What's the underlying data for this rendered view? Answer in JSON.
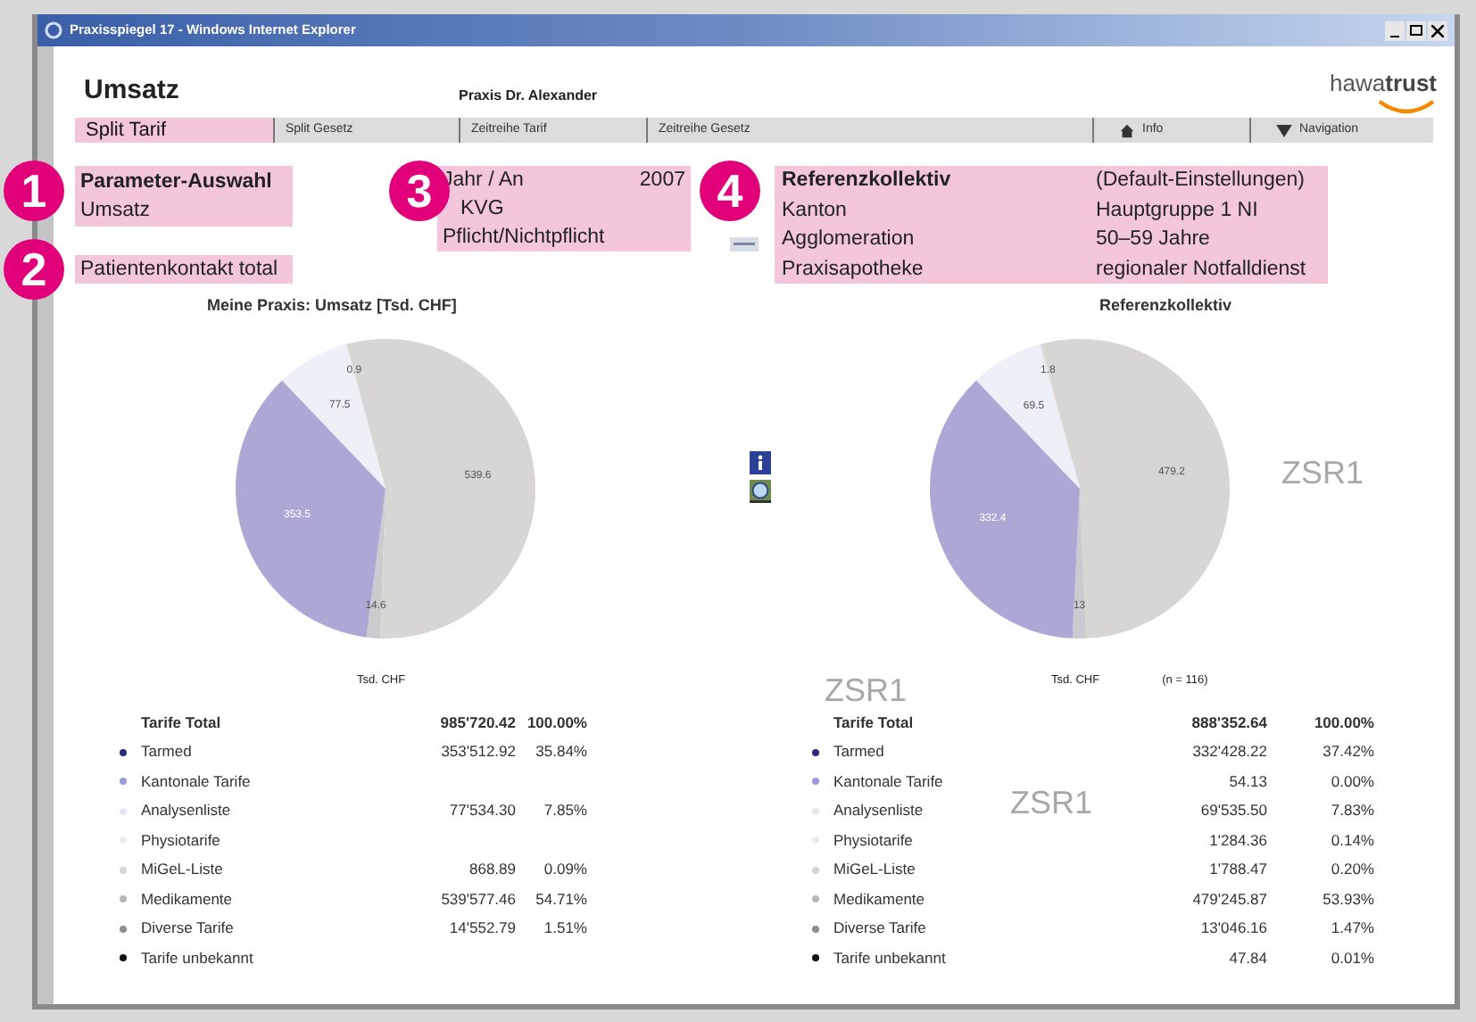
{
  "window": {
    "title": "Praxisspiegel 17 - Windows Internet Explorer"
  },
  "header": {
    "title": "Umsatz",
    "practice": "Praxis Dr. Alexander",
    "logo": {
      "light": "hawa",
      "bold": "trust"
    }
  },
  "tabs": [
    {
      "label": "Split Tarif",
      "selected": true,
      "kind": "plain"
    },
    {
      "label": "Split Gesetz",
      "selected": false,
      "kind": "plain"
    },
    {
      "label": "Zeitreihe Tarif",
      "selected": false,
      "kind": "plain"
    },
    {
      "label": "Zeitreihe Gesetz",
      "selected": false,
      "kind": "plain"
    },
    {
      "label": "Info",
      "selected": false,
      "kind": "home"
    },
    {
      "label": "Navigation",
      "selected": false,
      "kind": "menu"
    }
  ],
  "callouts": [
    {
      "number": "1"
    },
    {
      "number": "2"
    },
    {
      "number": "3"
    },
    {
      "number": "4"
    }
  ],
  "selection": {
    "parameter": {
      "label": "Parameter-Auswahl",
      "value": "Umsatz"
    },
    "contact": "Patientenkontakt total",
    "period": {
      "label": "Jahr / An",
      "year": "2007",
      "law": "KVG",
      "duty": "Pflicht/Nichtpflicht"
    },
    "reference": {
      "title": "Referenzkollektiv",
      "title_value": "(Default-Einstellungen)",
      "rows": [
        {
          "label": "Kanton",
          "value": "Hauptgruppe 1 NI"
        },
        {
          "label": "Agglomeration",
          "value": "50–59 Jahre"
        },
        {
          "label": "Praxisapotheke",
          "value": "regionaler Notfalldienst"
        }
      ]
    }
  },
  "panels": [
    {
      "title": "Meine Praxis: Umsatz [Tsd. CHF]",
      "unit": "Tsd. CHF",
      "chart_data": {
        "type": "pie",
        "values": [
          539.6,
          14.6,
          353.5,
          77.5,
          0.9
        ],
        "colors": [
          "#d8d5d5",
          "#cbcbcf",
          "#aca8d6",
          "#eef0f8",
          "#e2e2e2"
        ],
        "data_labels": true
      },
      "table": {
        "total": {
          "name": "Tarife Total",
          "value": "985'720.42",
          "share": "100.00%"
        },
        "rows": [
          {
            "name": "Tarmed",
            "value": "353'512.92",
            "share": "35.84%",
            "color": "#2a2a80"
          },
          {
            "name": "Kantonale Tarife",
            "color": "#9a9ad8"
          },
          {
            "name": "Analysenliste",
            "value": "77'534.30",
            "share": "7.85%",
            "color": "#e4e6f4"
          },
          {
            "name": "Physiotarife",
            "color": "#ececec"
          },
          {
            "name": "MiGeL-Liste",
            "value": "868.89",
            "share": "0.09%",
            "color": "#d4d4d4"
          },
          {
            "name": "Medikamente",
            "value": "539'577.46",
            "share": "54.71%",
            "color": "#b8b8b8"
          },
          {
            "name": "Diverse Tarife",
            "value": "14'552.79",
            "share": "1.51%",
            "color": "#8c8c8c"
          },
          {
            "name": "Tarife unbekannt",
            "color": "#111111"
          }
        ]
      }
    },
    {
      "title": "Referenzkollektiv",
      "unit": "Tsd. CHF",
      "n": "(n = 116)",
      "chart_data": {
        "type": "pie",
        "values": [
          479.2,
          13.0,
          332.4,
          69.5,
          1.8
        ],
        "colors": [
          "#d8d5d5",
          "#cbcbcf",
          "#aca8d6",
          "#eef0f8",
          "#e2e2e2"
        ],
        "data_labels": true
      },
      "table": {
        "total": {
          "name": "Tarife Total",
          "value": "888'352.64",
          "share": "100.00%"
        },
        "rows": [
          {
            "name": "Tarmed",
            "value": "332'428.22",
            "share": "37.42%",
            "color": "#2a2a80"
          },
          {
            "name": "Kantonale Tarife",
            "value": "54.13",
            "share": "0.00%",
            "color": "#9a9ad8"
          },
          {
            "name": "Analysenliste",
            "value": "69'535.50",
            "share": "7.83%",
            "color": "#e4e6f4"
          },
          {
            "name": "Physiotarife",
            "value": "1'284.36",
            "share": "0.14%",
            "color": "#ececec"
          },
          {
            "name": "MiGeL-Liste",
            "value": "1'788.47",
            "share": "0.20%",
            "color": "#d4d4d4"
          },
          {
            "name": "Medikamente",
            "value": "479'245.87",
            "share": "53.93%",
            "color": "#b8b8b8"
          },
          {
            "name": "Diverse Tarife",
            "value": "13'046.16",
            "share": "1.47%",
            "color": "#8c8c8c"
          },
          {
            "name": "Tarife unbekannt",
            "value": "47.84",
            "share": "0.01%",
            "color": "#111111"
          }
        ]
      }
    }
  ],
  "stamps": [
    "ZSR1",
    "ZSR1",
    "ZSR1"
  ]
}
